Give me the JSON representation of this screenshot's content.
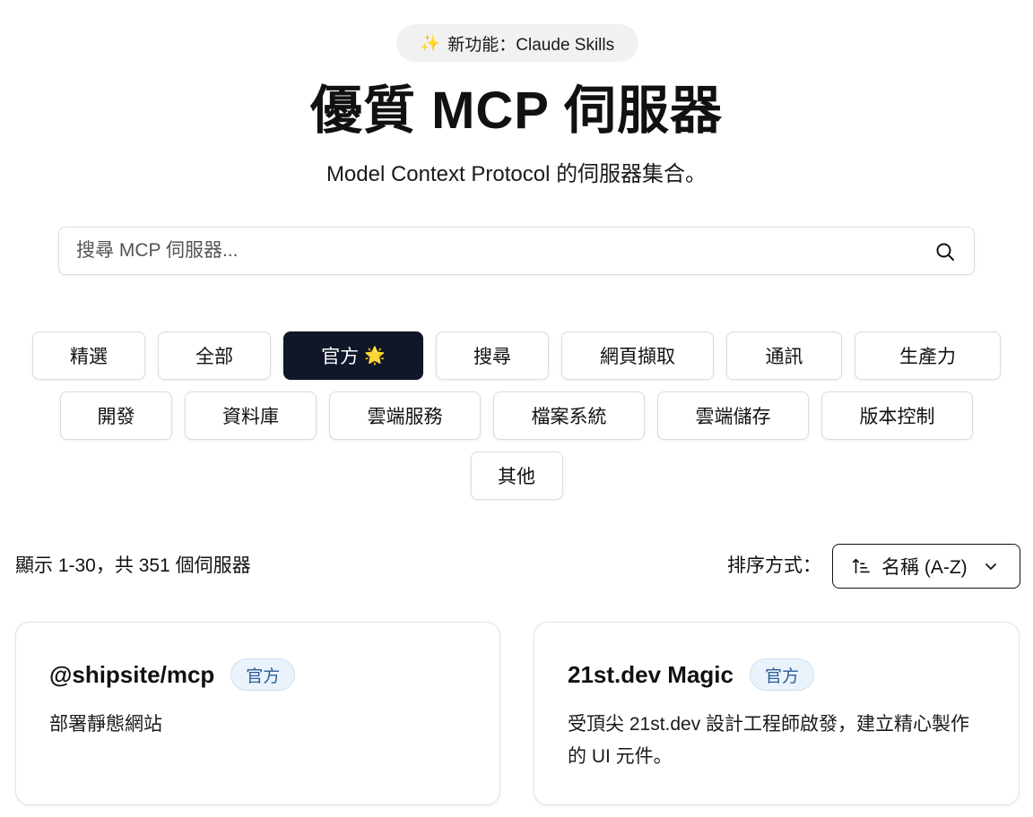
{
  "announcement": {
    "icon": "sparkle-icon",
    "text": "新功能：Claude Skills"
  },
  "hero": {
    "title": "優質 MCP 伺服器",
    "subtitle": "Model Context Protocol 的伺服器集合。"
  },
  "search": {
    "placeholder": "搜尋 MCP 伺服器...",
    "value": ""
  },
  "categories": {
    "row1": [
      "精選",
      "全部",
      "官方",
      "搜尋",
      "網頁擷取",
      "通訊",
      "生產力"
    ],
    "row2": [
      "開發",
      "資料庫",
      "雲端服務",
      "檔案系統",
      "雲端儲存",
      "版本控制"
    ],
    "row3": [
      "其他"
    ],
    "active": "官方",
    "active_emoji": "🌟"
  },
  "results": {
    "count_text": "顯示 1-30，共 351 個伺服器",
    "sort_label": "排序方式：",
    "sort_value": "名稱 (A-Z)"
  },
  "cards": [
    {
      "title": "@shipsite/mcp",
      "badge": "官方",
      "description": "部署靜態網站"
    },
    {
      "title": "21st.dev Magic",
      "badge": "官方",
      "description": "受頂尖 21st.dev 設計工程師啟發，建立精心製作的 UI 元件。"
    }
  ],
  "colors": {
    "active_chip_bg": "#0f1729",
    "badge_bg": "#eaf3fc",
    "badge_text": "#2b5c99"
  }
}
